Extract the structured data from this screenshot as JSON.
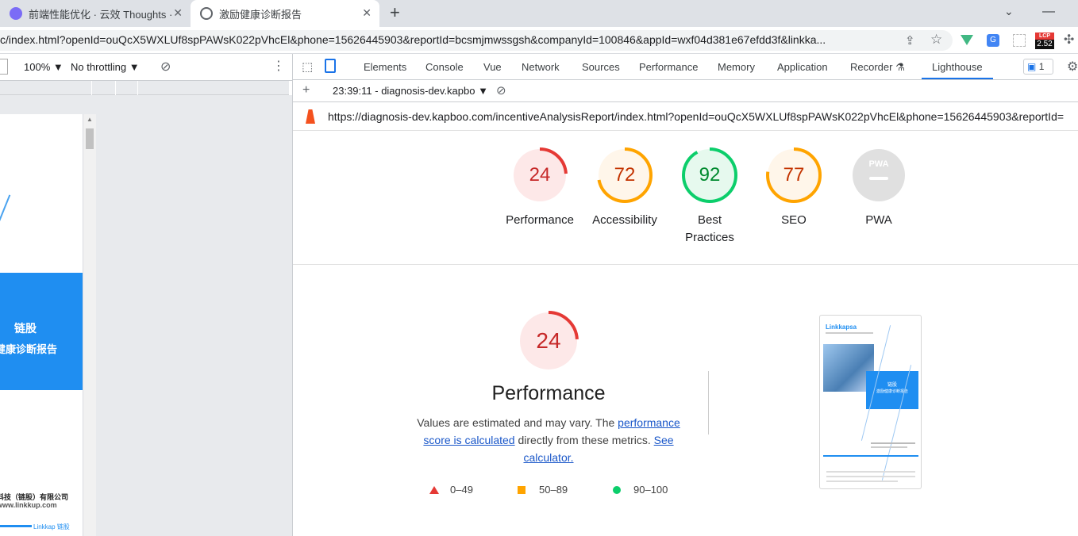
{
  "browser": {
    "tabs": [
      {
        "title": "前端性能优化 · 云效 Thoughts ·",
        "active": false
      },
      {
        "title": "激励健康诊断报告",
        "active": true
      }
    ],
    "new_tab": "+",
    "url": "c/index.html?openId=ouQcX5WXLUf8spPAWsK022pVhcEl&phone=15626445903&reportId=bcsmjmwssgsh&companyId=100846&appId=wxf04d381e67efdd3f&linkka...",
    "lcp_badge": {
      "top": "LCP",
      "value": "2.52"
    }
  },
  "device_toolbar": {
    "zoom": "100%",
    "throttling": "No throttling"
  },
  "device_page": {
    "brand": "链股",
    "title": "健康诊断报告",
    "company": "科技（链股）有限公司",
    "website": "www.linkkup.com",
    "footer_logo": "Linkkap 链股"
  },
  "devtools": {
    "tabs": [
      "Elements",
      "Console",
      "Vue",
      "Network",
      "Sources",
      "Performance",
      "Memory",
      "Application",
      "Recorder",
      "Lighthouse"
    ],
    "active_tab": "Lighthouse",
    "issues_count": "1",
    "report_selector": "23:39:11 - diagnosis-dev.kapbo",
    "report_url": "https://diagnosis-dev.kapboo.com/incentiveAnalysisReport/index.html?openId=ouQcX5WXLUf8spPAWsK022pVhcEl&phone=15626445903&reportId="
  },
  "lighthouse": {
    "scores": [
      {
        "label": "Performance",
        "value": "24",
        "score": 24,
        "color": "#e53935",
        "bg": "#fde8e8"
      },
      {
        "label": "Accessibility",
        "value": "72",
        "score": 72,
        "color": "#ffa400",
        "bg": "#fff6ea"
      },
      {
        "label": "Best Practices",
        "value": "92",
        "score": 92,
        "color": "#0cce6b",
        "bg": "#e6f9ee"
      },
      {
        "label": "SEO",
        "value": "77",
        "score": 77,
        "color": "#ffa400",
        "bg": "#fff6ea"
      },
      {
        "label": "PWA",
        "value": "PWA",
        "score": null,
        "color": "#9e9e9e",
        "bg": "#e0e0e0"
      }
    ],
    "detail": {
      "score": "24",
      "title": "Performance",
      "desc_prefix": "Values are estimated and may vary. The ",
      "desc_link1": "performance score is calculated",
      "desc_middle": " directly from these metrics. ",
      "desc_link2": "See calculator."
    },
    "legend": [
      {
        "range": "0–49",
        "color": "#e53935",
        "shape": "triangle"
      },
      {
        "range": "50–89",
        "color": "#ffa400",
        "shape": "square"
      },
      {
        "range": "90–100",
        "color": "#0cce6b",
        "shape": "circle"
      }
    ],
    "thumbnail": {
      "brand": "Linkkapsa",
      "title_line1": "链股",
      "title_line2": "激励健康诊断报告"
    }
  }
}
